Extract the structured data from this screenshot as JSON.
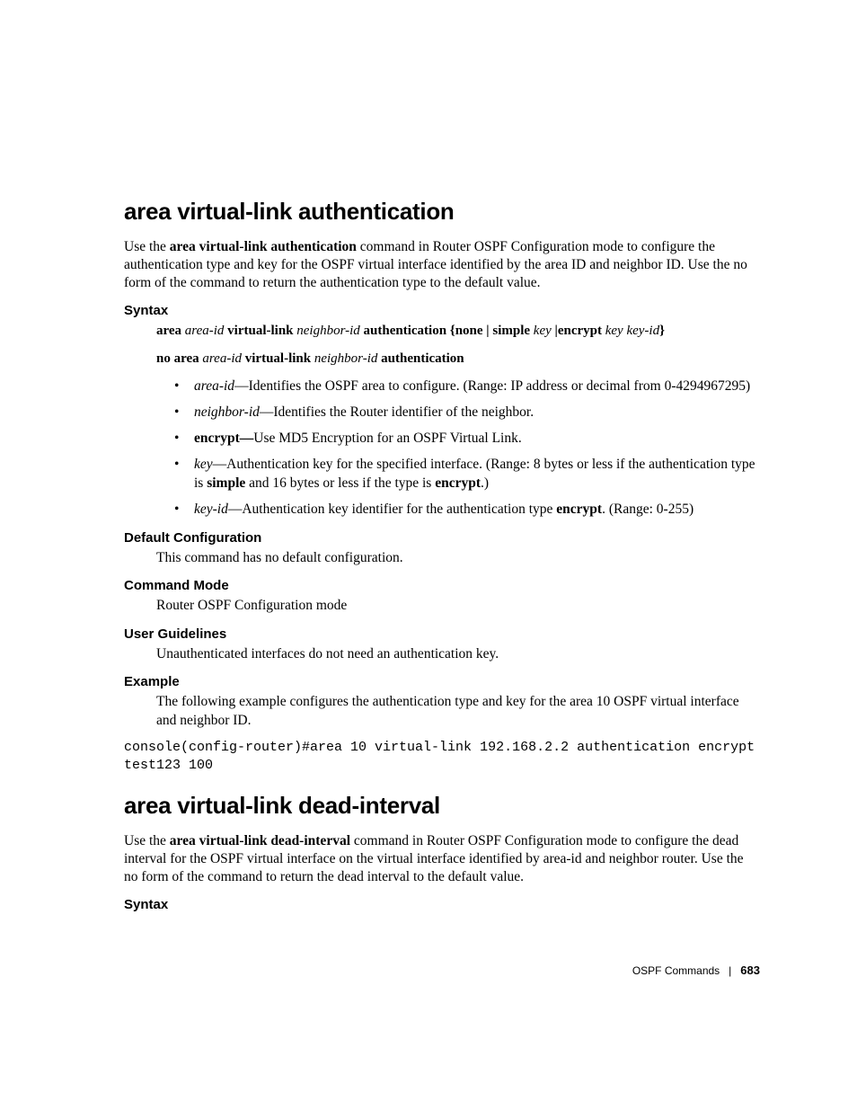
{
  "section1": {
    "title": "area virtual-link authentication",
    "intro_pre": "Use the ",
    "intro_cmd": "area virtual-link authentication",
    "intro_post": " command in Router OSPF Configuration mode to configure the authentication type and key for the OSPF virtual interface identified by the area ID and neighbor ID.  Use the no form of the command to return the authentication type to the default value.",
    "syntax_heading": "Syntax",
    "syntax1": {
      "p1": "area ",
      "p2": "area-id",
      "p3": " virtual-link ",
      "p4": "neighbor-id",
      "p5": " authentication {none | simple ",
      "p6": "key",
      "p7": " |encrypt ",
      "p8": "key key-id",
      "p9": "}"
    },
    "syntax2": {
      "p1": "no area ",
      "p2": "area-id",
      "p3": " virtual-link ",
      "p4": "neighbor-id",
      "p5": " authentication"
    },
    "bullets": {
      "b1_i": "area-id",
      "b1_t": "—Identifies the OSPF area to configure. (Range: IP address or decimal from 0-4294967295)",
      "b2_i": "neighbor-id",
      "b2_t": "—Identifies the Router identifier of the neighbor.",
      "b3_b": "encrypt—",
      "b3_t": "Use MD5 Encryption for an OSPF Virtual Link.",
      "b4_i": "key",
      "b4_t1": "—Authentication key for the specified interface. (Range: 8 bytes or less if the authentication type is ",
      "b4_b1": "simple",
      "b4_t2": " and 16 bytes or less if the type is ",
      "b4_b2": "encrypt",
      "b4_t3": ".)",
      "b5_i": "key-id",
      "b5_t1": "—Authentication key identifier for the authentication type ",
      "b5_b": "encrypt",
      "b5_t2": ". (Range: 0-255)"
    },
    "defcfg_heading": "Default Configuration",
    "defcfg_text": "This command has no default configuration.",
    "mode_heading": "Command Mode",
    "mode_text": "Router OSPF Configuration mode",
    "ug_heading": "User Guidelines",
    "ug_text": "Unauthenticated interfaces do not need an authentication key.",
    "ex_heading": "Example",
    "ex_text": "The following example configures the authentication type and key for the area 10 OSPF virtual interface  and neighbor ID.",
    "console": "console(config-router)#area 10 virtual-link 192.168.2.2 authentication encrypt test123 100"
  },
  "section2": {
    "title": "area virtual-link dead-interval",
    "intro_pre": "Use the ",
    "intro_cmd": "area virtual-link dead-interval",
    "intro_post": " command in Router OSPF Configuration mode to configure the dead interval for the OSPF virtual interface on the virtual interface identified by area-id and neighbor router. Use the no form of the command to return the dead interval to the default value.",
    "syntax_heading": "Syntax"
  },
  "footer": {
    "section": "OSPF Commands",
    "page": "683"
  }
}
